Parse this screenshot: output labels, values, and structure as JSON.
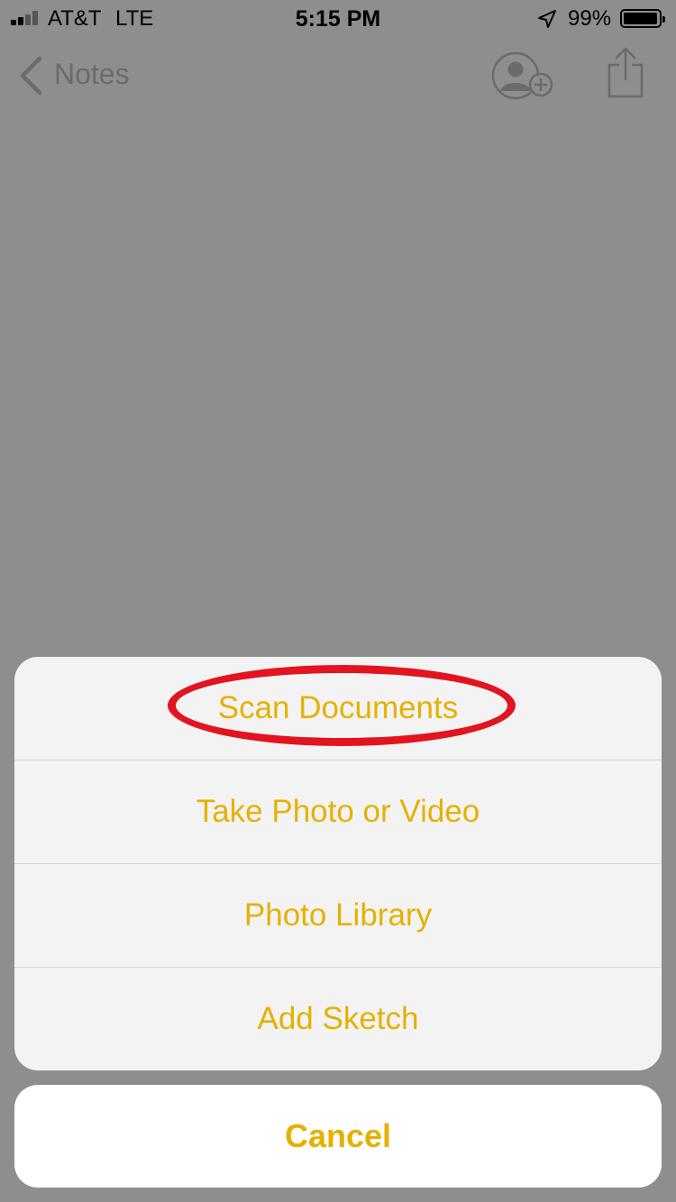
{
  "status_bar": {
    "carrier": "AT&T",
    "network": "LTE",
    "time": "5:15 PM",
    "battery_percent": "99%"
  },
  "nav_bar": {
    "back_label": "Notes"
  },
  "action_sheet": {
    "items": [
      {
        "label": "Scan Documents"
      },
      {
        "label": "Take Photo or Video"
      },
      {
        "label": "Photo Library"
      },
      {
        "label": "Add Sketch"
      }
    ],
    "cancel_label": "Cancel"
  },
  "colors": {
    "accent": "#e5b100",
    "highlight_ring": "#e2141f",
    "dim_overlay": "#8e8e8e"
  }
}
